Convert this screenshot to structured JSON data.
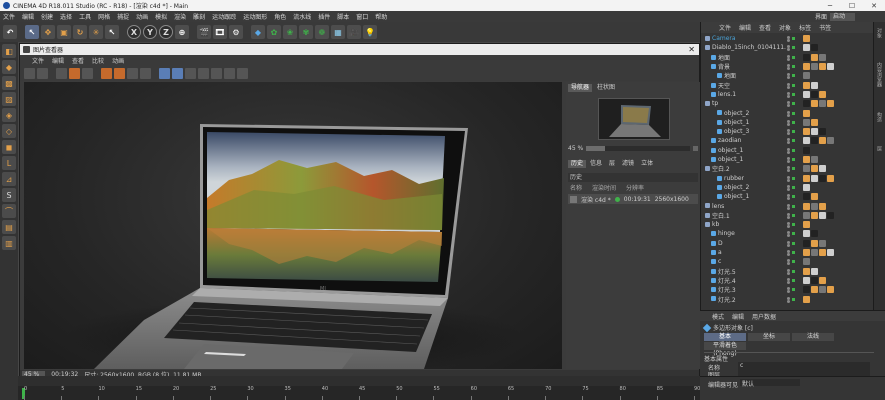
{
  "app": {
    "title": "CINEMA 4D R18.011 Studio (RC - R18) - [渲染 c4d *] - Main",
    "window_controls": [
      "─",
      "☐",
      "✕"
    ]
  },
  "menubar": {
    "items": [
      "文件",
      "编辑",
      "创建",
      "选择",
      "工具",
      "网格",
      "捕捉",
      "动画",
      "模拟",
      "渲染",
      "雕刻",
      "运动跟踪",
      "运动图形",
      "角色",
      "流水线",
      "插件",
      "脚本",
      "窗口",
      "帮助"
    ],
    "layout_label": "界面",
    "layout_value": "启动"
  },
  "picture_viewer": {
    "title": "图片查看器",
    "menu": [
      "文件",
      "编辑",
      "查看",
      "比较",
      "动画"
    ],
    "tabs": [
      "导航器",
      "柱状图"
    ],
    "zoom": "45 %",
    "history_tabs": [
      "历史",
      "信息",
      "层",
      "滤镜",
      "立体"
    ],
    "history_header": "历史",
    "history_columns": [
      "名称",
      "渲染时间",
      "分辨率"
    ],
    "history_row": {
      "name": "渲染 c4d *",
      "time": "00:19:31",
      "res": "2560x1600"
    },
    "status_zoom": "45 %",
    "status_time": "00:19:32",
    "status_info": "尺寸: 2560x1600, RGB (8 位), 11.81 MB",
    "screen_logo": "MI"
  },
  "object_manager": {
    "menu": [
      "文件",
      "编辑",
      "查看",
      "对象",
      "标签",
      "书签"
    ],
    "objects": [
      {
        "name": "Camera",
        "depth": 0,
        "color": "#4aa3d8"
      },
      {
        "name": "Diablo_15inch_0104111.obj",
        "depth": 0,
        "color": "#cfcfcf"
      },
      {
        "name": "地面",
        "depth": 1,
        "color": "#cfcfcf"
      },
      {
        "name": "背景",
        "depth": 1,
        "color": "#cfcfcf"
      },
      {
        "name": "地面",
        "depth": 2,
        "color": "#cfcfcf"
      },
      {
        "name": "天空",
        "depth": 1,
        "color": "#cfcfcf"
      },
      {
        "name": "lens.1",
        "depth": 1,
        "color": "#cfcfcf"
      },
      {
        "name": "tp",
        "depth": 0,
        "color": "#cfcfcf"
      },
      {
        "name": "object_2",
        "depth": 2,
        "color": "#cfcfcf"
      },
      {
        "name": "object_1",
        "depth": 2,
        "color": "#cfcfcf"
      },
      {
        "name": "object_3",
        "depth": 2,
        "color": "#cfcfcf"
      },
      {
        "name": "zaodian",
        "depth": 1,
        "color": "#cfcfcf"
      },
      {
        "name": "object_1",
        "depth": 1,
        "color": "#cfcfcf"
      },
      {
        "name": "object_1",
        "depth": 1,
        "color": "#cfcfcf"
      },
      {
        "name": "空白.2",
        "depth": 0,
        "color": "#cfcfcf"
      },
      {
        "name": "rubber",
        "depth": 2,
        "color": "#cfcfcf"
      },
      {
        "name": "object_2",
        "depth": 2,
        "color": "#cfcfcf"
      },
      {
        "name": "object_1",
        "depth": 2,
        "color": "#cfcfcf"
      },
      {
        "name": "lens",
        "depth": 0,
        "color": "#cfcfcf"
      },
      {
        "name": "空白.1",
        "depth": 0,
        "color": "#cfcfcf"
      },
      {
        "name": "kb",
        "depth": 0,
        "color": "#cfcfcf"
      },
      {
        "name": "hinge",
        "depth": 1,
        "color": "#cfcfcf"
      },
      {
        "name": "D",
        "depth": 1,
        "color": "#cfcfcf"
      },
      {
        "name": "a",
        "depth": 1,
        "color": "#cfcfcf"
      },
      {
        "name": "c",
        "depth": 1,
        "color": "#cfcfcf"
      },
      {
        "name": "灯光.5",
        "depth": 1,
        "color": "#cfcfcf"
      },
      {
        "name": "灯光.4",
        "depth": 1,
        "color": "#cfcfcf"
      },
      {
        "name": "灯光.3",
        "depth": 1,
        "color": "#cfcfcf"
      },
      {
        "name": "灯光.2",
        "depth": 1,
        "color": "#cfcfcf"
      }
    ]
  },
  "side_tabs": [
    "对象",
    "内容浏览器",
    "构造",
    "层"
  ],
  "attributes": {
    "menu": [
      "模式",
      "编辑",
      "用户数据"
    ],
    "object_label": "多边形对象 [c]",
    "tabs": [
      "基本",
      "坐标",
      "平滑着色(Phong)"
    ],
    "tab_extra": [
      "法线"
    ],
    "section": "基本属性",
    "fields": [
      {
        "label": "名称",
        "value": "c"
      },
      {
        "label": "图层",
        "value": ""
      },
      {
        "label": "编辑器可见",
        "value": "默认"
      }
    ]
  },
  "timeline": {
    "ticks": [
      "0",
      "5",
      "10",
      "15",
      "20",
      "25",
      "30",
      "35",
      "40",
      "45",
      "50",
      "55",
      "60",
      "65",
      "70",
      "75",
      "80",
      "85",
      "90"
    ]
  },
  "colors": {
    "accent_orange": "#e3a04a",
    "selection_blue": "#5d6b86",
    "c4d_blue": "#1e4fa0"
  }
}
